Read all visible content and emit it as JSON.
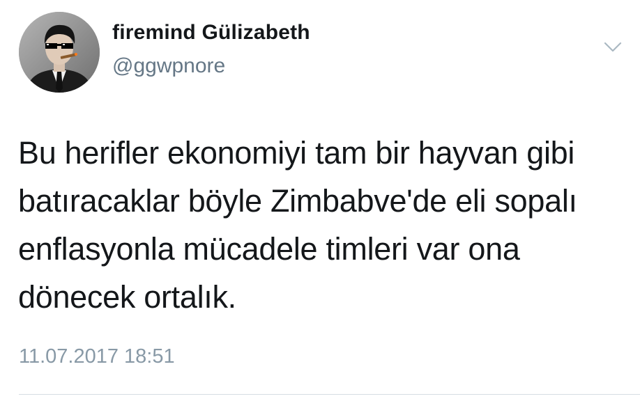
{
  "tweet": {
    "author": {
      "display_name": "firemind Gülizabeth",
      "handle": "@ggwpnore",
      "avatar_icon": "profile-photo-avatar"
    },
    "menu_icon": "chevron-down-icon",
    "text": "Bu herifler ekonomiyi tam bir hayvan gibi\nbatıracaklar böyle Zimbabve'de eli sopalı\nenflasyonla mücadele timleri var ona\ndönecek ortalık.",
    "timestamp": "11.07.2017 18:51"
  },
  "colors": {
    "text": "#14171a",
    "secondary": "#657786",
    "timestamp": "#8899a6",
    "divider": "#d6dde3",
    "background": "#ffffff"
  }
}
